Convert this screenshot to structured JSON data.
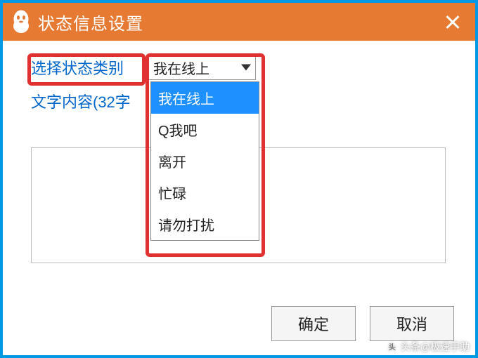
{
  "titlebar": {
    "title": "状态信息设置"
  },
  "form": {
    "category_label": "选择状态类别",
    "content_label": "文字内容(32字",
    "selected_value": "我在线上"
  },
  "dropdown": {
    "items": [
      {
        "label": "我在线上",
        "selected": true
      },
      {
        "label": "Q我吧",
        "selected": false
      },
      {
        "label": "离开",
        "selected": false
      },
      {
        "label": "忙碌",
        "selected": false
      },
      {
        "label": "请勿打扰",
        "selected": false
      }
    ]
  },
  "buttons": {
    "ok": "确定",
    "cancel": "取消"
  },
  "watermark": {
    "text": "头条@极速手助"
  },
  "colors": {
    "frame": "#0099e6",
    "titlebar": "#e67a33",
    "highlight": "#e03030",
    "link": "#0066cc",
    "selection": "#1e90ff"
  }
}
